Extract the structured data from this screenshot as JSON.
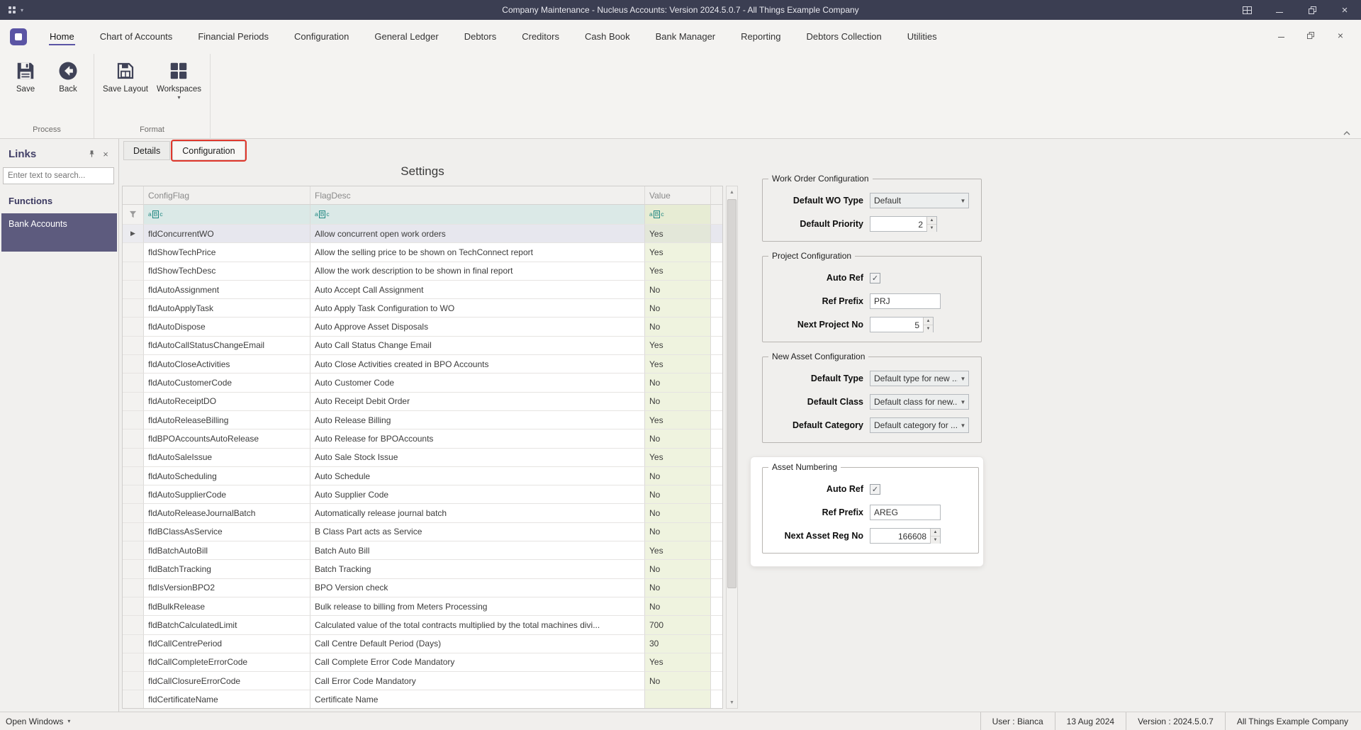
{
  "colors": {
    "titlebar_bg": "#3b3e52",
    "accent_purple": "#5b55a5",
    "selected_item_bg": "#5d5b7e",
    "annotation_red": "#e0372c",
    "value_column_tint": "#eff3df",
    "filter_row_tint": "#dbe9e7"
  },
  "titlebar": {
    "title": "Company Maintenance - Nucleus Accounts: Version 2024.5.0.7 - All Things Example Company",
    "control_icons": [
      "layout-icon",
      "minimize-icon",
      "restore-icon",
      "close-icon"
    ]
  },
  "ribbon": {
    "tabs": [
      {
        "label": "Home",
        "active": true
      },
      {
        "label": "Chart of Accounts"
      },
      {
        "label": "Financial Periods"
      },
      {
        "label": "Configuration"
      },
      {
        "label": "General Ledger"
      },
      {
        "label": "Debtors"
      },
      {
        "label": "Creditors"
      },
      {
        "label": "Cash Book"
      },
      {
        "label": "Bank Manager"
      },
      {
        "label": "Reporting"
      },
      {
        "label": "Debtors Collection"
      },
      {
        "label": "Utilities"
      }
    ],
    "groups": [
      {
        "label": "Process",
        "buttons": [
          {
            "label": "Save",
            "icon": "save-icon"
          },
          {
            "label": "Back",
            "icon": "back-icon"
          }
        ]
      },
      {
        "label": "Format",
        "buttons": [
          {
            "label": "Save Layout",
            "icon": "save-layout-icon"
          },
          {
            "label": "Workspaces",
            "icon": "workspaces-icon",
            "has_dropdown": true
          }
        ]
      }
    ]
  },
  "links_panel": {
    "title": "Links",
    "icons": [
      "pin-icon",
      "close-icon",
      "search-icon"
    ],
    "search_placeholder": "Enter text to search...",
    "section": "Functions",
    "items": [
      {
        "label": "Bank Accounts",
        "selected": true
      }
    ]
  },
  "doc_tabs": [
    {
      "label": "Details"
    },
    {
      "label": "Configuration",
      "active": true,
      "highlighted": true
    }
  ],
  "grid": {
    "title": "Settings",
    "columns": [
      "ConfigFlag",
      "FlagDesc",
      "Value"
    ],
    "rows": [
      {
        "flag": "fldConcurrentWO",
        "desc": "Allow concurrent open work orders",
        "value": "Yes"
      },
      {
        "flag": "fldShowTechPrice",
        "desc": "Allow the selling price to be shown on TechConnect report",
        "value": "Yes"
      },
      {
        "flag": "fldShowTechDesc",
        "desc": "Allow the work description to be shown in final report",
        "value": "Yes"
      },
      {
        "flag": "fldAutoAssignment",
        "desc": "Auto Accept Call Assignment",
        "value": "No"
      },
      {
        "flag": "fldAutoApplyTask",
        "desc": "Auto Apply Task Configuration to WO",
        "value": "No"
      },
      {
        "flag": "fldAutoDispose",
        "desc": "Auto Approve Asset Disposals",
        "value": "No"
      },
      {
        "flag": "fldAutoCallStatusChangeEmail",
        "desc": "Auto Call Status Change Email",
        "value": "Yes"
      },
      {
        "flag": "fldAutoCloseActivities",
        "desc": "Auto Close Activities created in BPO Accounts",
        "value": "Yes"
      },
      {
        "flag": "fldAutoCustomerCode",
        "desc": "Auto Customer Code",
        "value": "No"
      },
      {
        "flag": "fldAutoReceiptDO",
        "desc": "Auto Receipt Debit Order",
        "value": "No"
      },
      {
        "flag": "fldAutoReleaseBilling",
        "desc": "Auto Release Billing",
        "value": "Yes"
      },
      {
        "flag": "fldBPOAccountsAutoRelease",
        "desc": "Auto Release for BPOAccounts",
        "value": "No"
      },
      {
        "flag": "fldAutoSaleIssue",
        "desc": "Auto Sale Stock Issue",
        "value": "Yes"
      },
      {
        "flag": "fldAutoScheduling",
        "desc": "Auto Schedule",
        "value": "No"
      },
      {
        "flag": "fldAutoSupplierCode",
        "desc": "Auto Supplier Code",
        "value": "No"
      },
      {
        "flag": "fldAutoReleaseJournalBatch",
        "desc": "Automatically release journal batch",
        "value": "No"
      },
      {
        "flag": "fldBClassAsService",
        "desc": "B Class Part acts as Service",
        "value": "No"
      },
      {
        "flag": "fldBatchAutoBill",
        "desc": "Batch Auto Bill",
        "value": "Yes"
      },
      {
        "flag": "fldBatchTracking",
        "desc": "Batch Tracking",
        "value": "No"
      },
      {
        "flag": "fldIsVersionBPO2",
        "desc": "BPO Version check",
        "value": "No"
      },
      {
        "flag": "fldBulkRelease",
        "desc": "Bulk release to billing from Meters Processing",
        "value": "No"
      },
      {
        "flag": "fldBatchCalculatedLimit",
        "desc": "Calculated value of the total contracts multiplied by the total machines divi...",
        "value": "700"
      },
      {
        "flag": "fldCallCentrePeriod",
        "desc": "Call Centre Default Period (Days)",
        "value": "30"
      },
      {
        "flag": "fldCallCompleteErrorCode",
        "desc": "Call Complete Error Code Mandatory",
        "value": "Yes"
      },
      {
        "flag": "fldCallClosureErrorCode",
        "desc": "Call Error Code Mandatory",
        "value": "No"
      },
      {
        "flag": "fldCertificateName",
        "desc": "Certificate Name",
        "value": ""
      }
    ]
  },
  "panels": {
    "work_order": {
      "title": "Work Order Configuration",
      "default_wo_type_label": "Default WO Type",
      "default_wo_type_value": "Default",
      "default_priority_label": "Default Priority",
      "default_priority_value": "2"
    },
    "project": {
      "title": "Project Configuration",
      "auto_ref_label": "Auto Ref",
      "auto_ref_checked": true,
      "ref_prefix_label": "Ref Prefix",
      "ref_prefix_value": "PRJ",
      "next_project_no_label": "Next Project No",
      "next_project_no_value": "5"
    },
    "new_asset": {
      "title": "New Asset Configuration",
      "default_type_label": "Default Type",
      "default_type_value": "Default type for new ...",
      "default_class_label": "Default Class",
      "default_class_value": "Default class for new...",
      "default_category_label": "Default Category",
      "default_category_value": "Default category for ..."
    },
    "asset_numbering": {
      "title": "Asset Numbering",
      "auto_ref_label": "Auto Ref",
      "auto_ref_checked": true,
      "ref_prefix_label": "Ref Prefix",
      "ref_prefix_value": "AREG",
      "next_asset_reg_no_label": "Next Asset Reg No",
      "next_asset_reg_no_value": "166608"
    }
  },
  "statusbar": {
    "open_windows": "Open Windows",
    "right_items": [
      "User : Bianca",
      "13 Aug 2024",
      "Version : 2024.5.0.7",
      "All Things Example Company"
    ]
  }
}
